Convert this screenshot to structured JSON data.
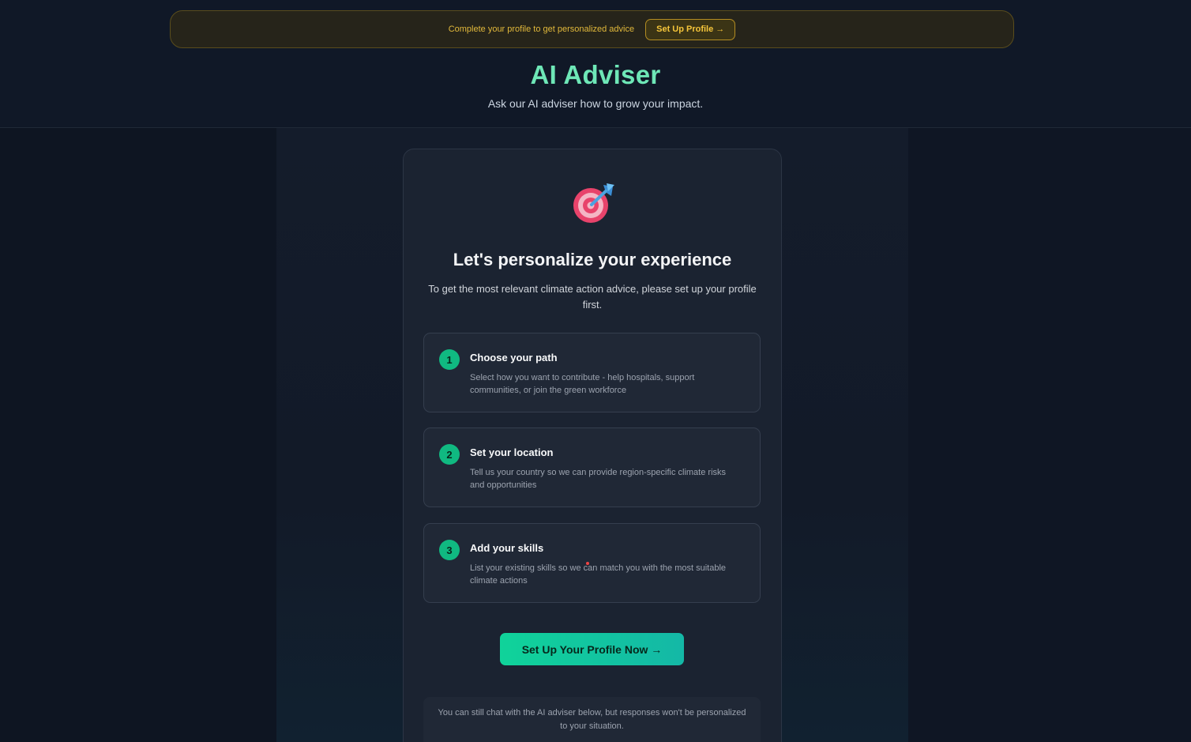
{
  "banner": {
    "text": "Complete your profile to get personalized advice",
    "button_label": "Set Up Profile →"
  },
  "header": {
    "title": "AI Adviser",
    "subtitle": "Ask our AI adviser how to grow your impact."
  },
  "card": {
    "icon": "target-dart-icon",
    "title": "Let's personalize your experience",
    "description": "To get the most relevant climate action advice, please set up your profile first.",
    "steps": [
      {
        "number": "1",
        "title": "Choose your path",
        "description": "Select how you want to contribute - help hospitals, support communities, or join the green workforce"
      },
      {
        "number": "2",
        "title": "Set your location",
        "description": "Tell us your country so we can provide region-specific climate risks and opportunities"
      },
      {
        "number": "3",
        "title": "Add your skills",
        "description": "List your existing skills so we can match you with the most suitable climate actions"
      }
    ],
    "cta_label": "Set Up Your Profile Now →",
    "note": "You can still chat with the AI adviser below, but responses won't be personalized to your situation."
  },
  "colors": {
    "accent": "#10b981",
    "title": "#6ee7b7",
    "banner_text": "#e2b93b"
  }
}
